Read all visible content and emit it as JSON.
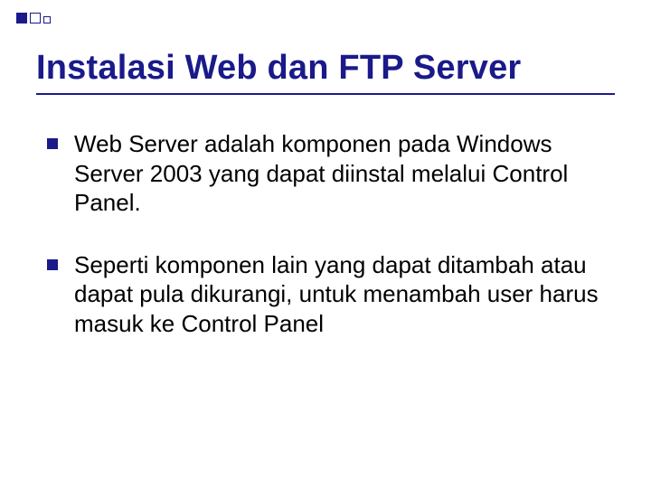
{
  "slide": {
    "title": "Instalasi Web dan FTP Server",
    "bullets": [
      "Web Server adalah komponen pada Windows Server 2003 yang dapat diinstal melalui Control Panel.",
      "Seperti komponen lain yang dapat ditambah atau dapat pula dikurangi, untuk menambah user harus masuk ke Control Panel"
    ]
  },
  "colors": {
    "accent": "#1a1a8a",
    "text": "#000000",
    "bg": "#ffffff"
  }
}
